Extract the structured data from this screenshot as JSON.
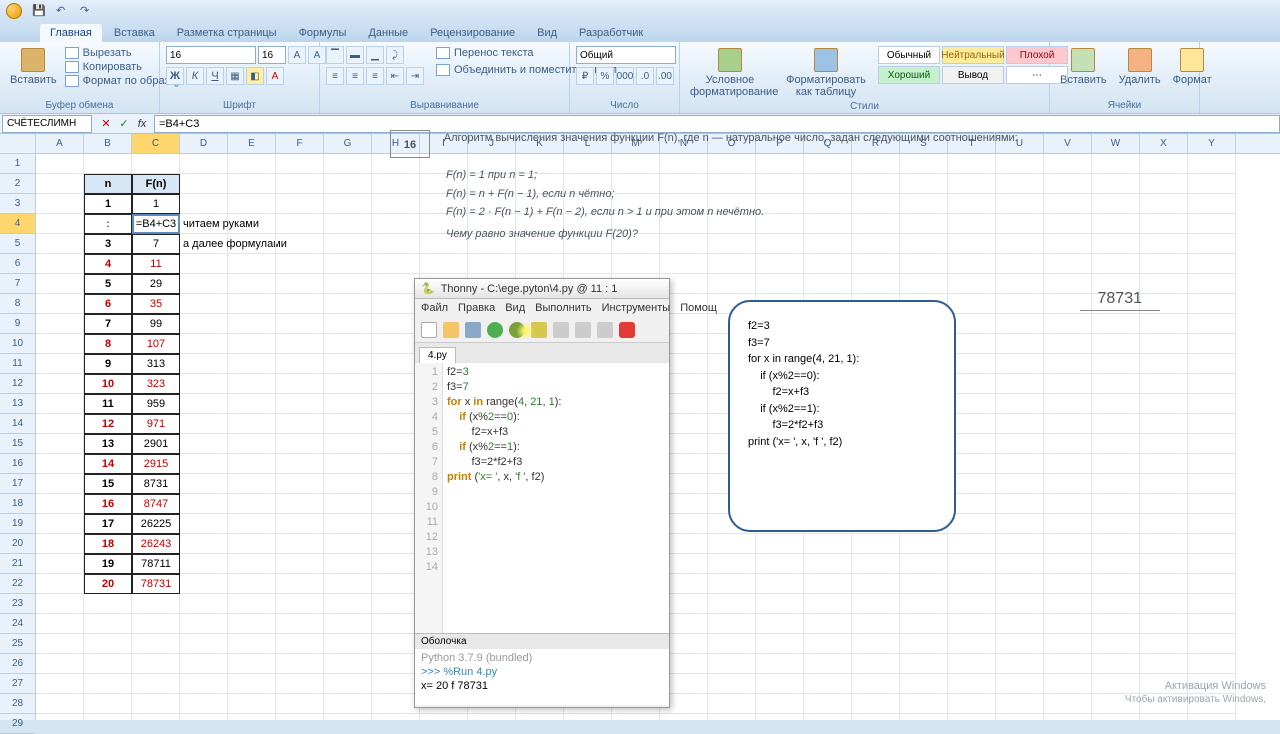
{
  "qat_tip": "Сохранить • Отменить • Повторить",
  "tabs": [
    "Главная",
    "Вставка",
    "Разметка страницы",
    "Формулы",
    "Данные",
    "Рецензирование",
    "Вид",
    "Разработчик"
  ],
  "ribbon": {
    "clipboard": {
      "paste": "Вставить",
      "cut": "Вырезать",
      "copy": "Копировать",
      "fmt": "Формат по образцу",
      "label": "Буфер обмена"
    },
    "font": {
      "size": "16",
      "label": "Шрифт"
    },
    "align": {
      "wrap": "Перенос текста",
      "merge": "Объединить и поместить в центре",
      "label": "Выравнивание"
    },
    "number": {
      "general": "Общий",
      "label": "Число"
    },
    "styles": {
      "cond": "Условное форматирование",
      "astable": "Форматировать как таблицу",
      "normal": "Обычный",
      "neutral": "Нейтральный",
      "bad": "Плохой",
      "good": "Хороший",
      "output": "Вывод",
      "label": "Стили"
    },
    "cells": {
      "insert": "Вставить",
      "delete": "Удалить",
      "format": "Формат",
      "label": "Ячейки"
    }
  },
  "namebox": "СЧЁТЕСЛИМН",
  "formula": "=B4+C3",
  "cols": [
    "A",
    "B",
    "C",
    "D",
    "E",
    "F",
    "G",
    "H",
    "I",
    "J",
    "K",
    "L",
    "M",
    "N",
    "O",
    "P",
    "Q",
    "R",
    "S",
    "T",
    "U",
    "V",
    "W",
    "X",
    "Y"
  ],
  "rows": 29,
  "active_row": 4,
  "active_col": "C",
  "table": {
    "header": [
      "n",
      "F(n)"
    ],
    "rows": [
      [
        "1",
        "1"
      ],
      [
        "",
        "=B4+C3"
      ],
      [
        "3",
        "7"
      ],
      [
        "4",
        "11"
      ],
      [
        "5",
        "29"
      ],
      [
        "6",
        "35"
      ],
      [
        "7",
        "99"
      ],
      [
        "8",
        "107"
      ],
      [
        "9",
        "313"
      ],
      [
        "10",
        "323"
      ],
      [
        "11",
        "959"
      ],
      [
        "12",
        "971"
      ],
      [
        "13",
        "2901"
      ],
      [
        "14",
        "2915"
      ],
      [
        "15",
        "8731"
      ],
      [
        "16",
        "8747"
      ],
      [
        "17",
        "26225"
      ],
      [
        "18",
        "26243"
      ],
      [
        "19",
        "78711"
      ],
      [
        "20",
        "78731"
      ]
    ]
  },
  "notes": {
    "n1": "читаем руками",
    "n2": "а далее формулами"
  },
  "problem": {
    "num": "16",
    "text": "Алгоритм вычисления значения функции F(n), где n — натуральное число, задан следующими соотношениями:",
    "f1": "F(n) = 1 при n = 1;",
    "f2": "F(n) = n + F(n − 1), если n чётно;",
    "f3": "F(n) = 2 · F(n − 1) + F(n − 2), если n > 1 и при этом n нечётно.",
    "ask": "Чему равно значение функции F(20)?",
    "answer": "78731"
  },
  "thonny": {
    "title": "Thonny  -  C:\\ege.pyton\\4.py  @  11 : 1",
    "menu": [
      "Файл",
      "Правка",
      "Вид",
      "Выполнить",
      "Инструменты",
      "Помощ"
    ],
    "tab": "4.py",
    "lines": [
      "1",
      "2",
      "3",
      "4",
      "5",
      "6",
      "7",
      "8",
      "9",
      "10",
      "11",
      "12",
      "13",
      "14"
    ],
    "code": {
      "l1a": "f2=",
      "l1b": "3",
      "l2a": "f3=",
      "l2b": "7",
      "l3a": "for",
      "l3b": " x ",
      "l3c": "in",
      "l3d": " range(",
      "l3e": "4",
      "l3f": ", ",
      "l3g": "21",
      "l3h": ", ",
      "l3i": "1",
      "l3j": "):",
      "l4a": "    if",
      "l4b": " (x%",
      "l4c": "2",
      "l4d": "==",
      "l4e": "0",
      "l4f": "):",
      "l5": "        f2=x+f3",
      "l6a": "    if",
      "l6b": " (x%",
      "l6c": "2",
      "l6d": "==",
      "l6e": "1",
      "l6f": "):",
      "l7": "        f3=2*f2+f3",
      "l8a": "print ",
      "l8b": "(",
      "l8c": "'x= '",
      "l8d": ", x, ",
      "l8e": "'f '",
      "l8f": ", f2)"
    },
    "shell_label": "Оболочка",
    "shell_py": "Python 3.7.9 (bundled)",
    "shell_run": ">>> %Run 4.py",
    "shell_out": "x=  20 f  78731"
  },
  "callout": [
    "f2=3",
    "f3=7",
    "for x in range(4, 21, 1):",
    "    if (x%2==0):",
    "        f2=x+f3",
    "    if (x%2==1):",
    "        f3=2*f2+f3",
    "print ('x= ', x, 'f ', f2)"
  ],
  "wm1": "Активация Windows",
  "wm2": "Чтобы активировать Windows,"
}
